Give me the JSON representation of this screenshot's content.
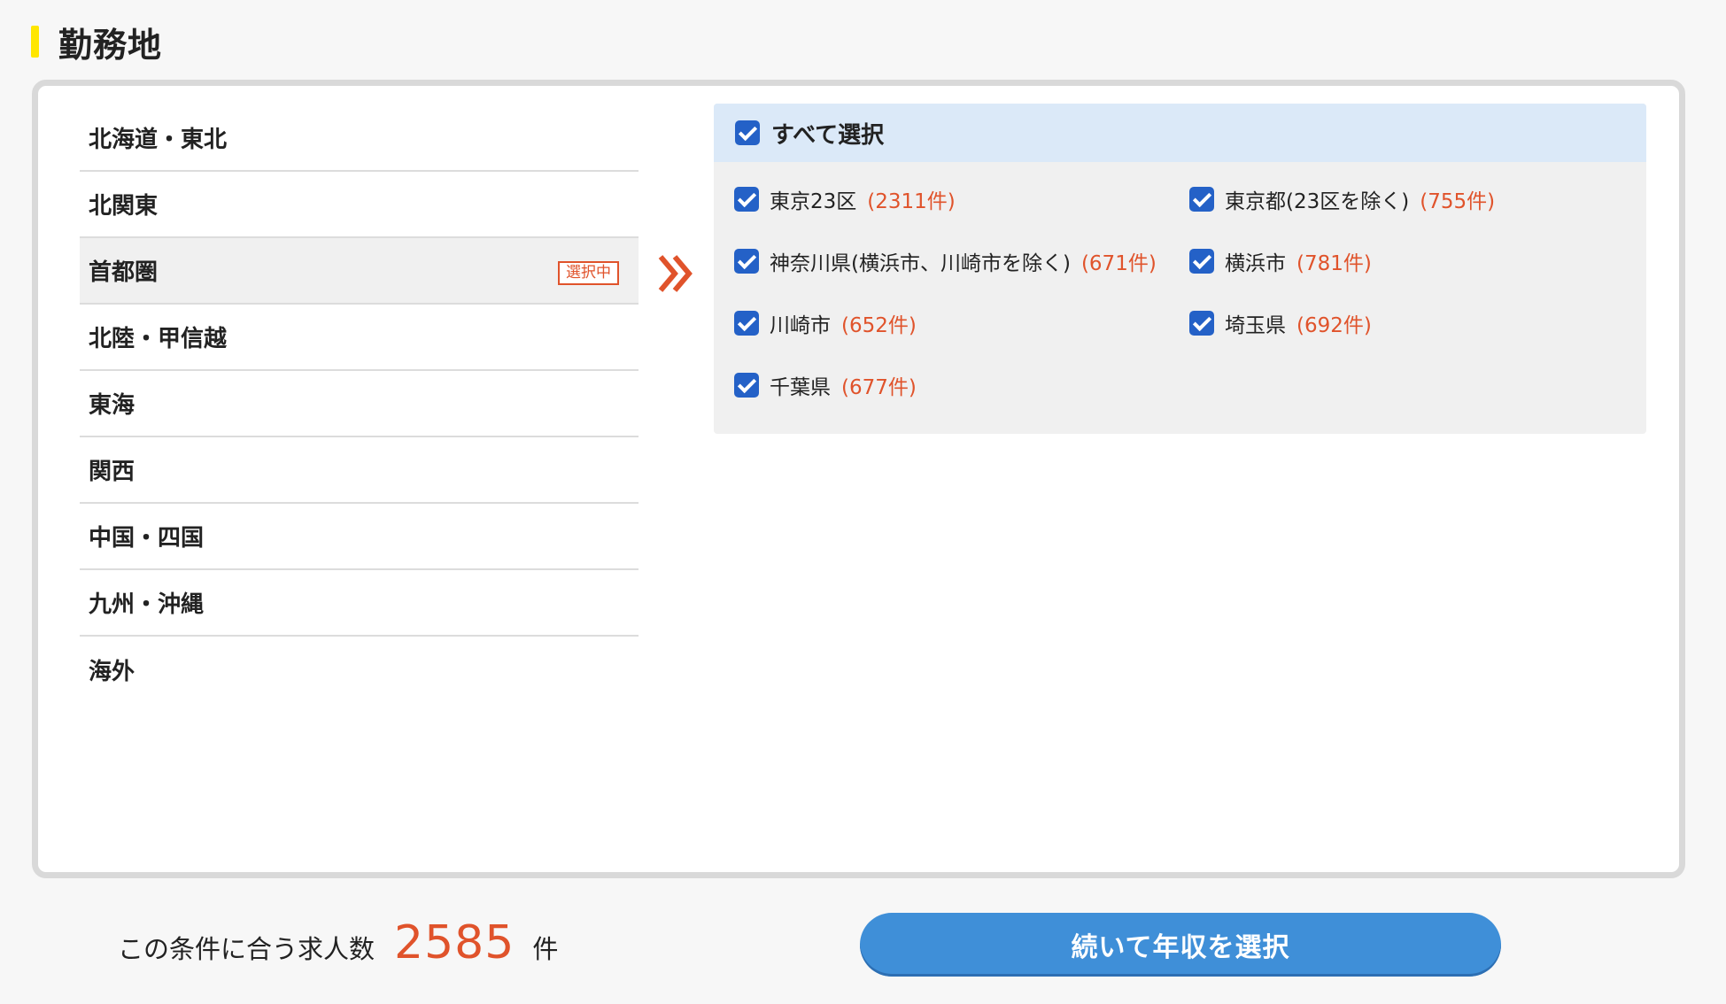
{
  "section_title": "勤務地",
  "regions": [
    {
      "label": "北海道・東北"
    },
    {
      "label": "北関東"
    },
    {
      "label": "首都圏",
      "badge": "選択中"
    },
    {
      "label": "北陸・甲信越"
    },
    {
      "label": "東海"
    },
    {
      "label": "関西"
    },
    {
      "label": "中国・四国"
    },
    {
      "label": "九州・沖縄"
    },
    {
      "label": "海外"
    }
  ],
  "select_all_label": "すべて選択",
  "options": [
    {
      "name": "東京23区",
      "count": "(2311件)"
    },
    {
      "name": "東京都(23区を除く)",
      "count": "(755件)"
    },
    {
      "name": "神奈川県(横浜市、川崎市を除く)",
      "count": "(671件)"
    },
    {
      "name": "横浜市",
      "count": "(781件)"
    },
    {
      "name": "川崎市",
      "count": "(652件)"
    },
    {
      "name": "埼玉県",
      "count": "(692件)"
    },
    {
      "name": "千葉県",
      "count": "(677件)"
    }
  ],
  "footer": {
    "label": "この条件に合う求人数",
    "count": "2585",
    "unit": "件",
    "next_button": "続いて年収を選択"
  },
  "colors": {
    "accent": "#e0532b",
    "checkbox": "#2461c7",
    "button": "#3f8fd8",
    "title_bar": "#ffe600"
  }
}
